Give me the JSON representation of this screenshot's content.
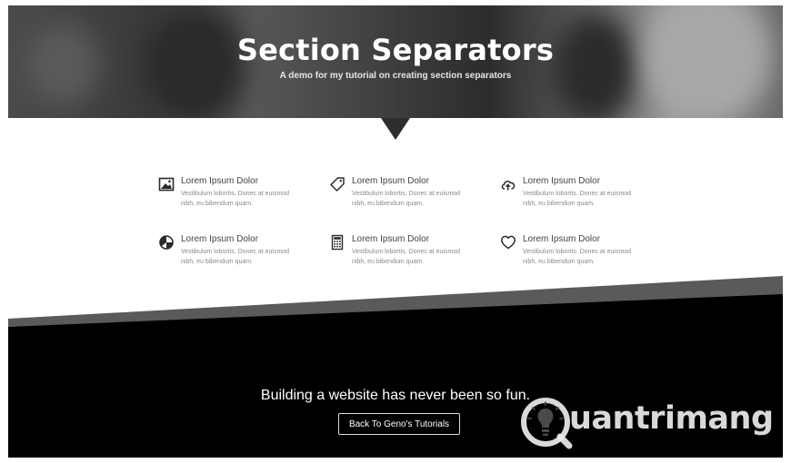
{
  "hero": {
    "title": "Section Separators",
    "subtitle": "A demo for my tutorial on creating section separators"
  },
  "features": [
    {
      "icon": "image-icon",
      "title": "Lorem Ipsum Dolor",
      "description": "Vestibulum lobortis. Donec at euismod nibh, eu bibendum quam."
    },
    {
      "icon": "tag-icon",
      "title": "Lorem Ipsum Dolor",
      "description": "Vestibulum lobortis. Donec at euismod nibh, eu bibendum quam."
    },
    {
      "icon": "cloud-upload-icon",
      "title": "Lorem Ipsum Dolor",
      "description": "Vestibulum lobortis. Donec at euismod nibh, eu bibendum quam."
    },
    {
      "icon": "pie-chart-icon",
      "title": "Lorem Ipsum Dolor",
      "description": "Vestibulum lobortis. Donec at euismod nibh, eu bibendum quam."
    },
    {
      "icon": "calculator-icon",
      "title": "Lorem Ipsum Dolor",
      "description": "Vestibulum lobortis. Donec at euismod nibh, eu bibendum quam."
    },
    {
      "icon": "heart-icon",
      "title": "Lorem Ipsum Dolor",
      "description": "Vestibulum lobortis. Donec at euismod nibh, eu bibendum quam."
    }
  ],
  "footer": {
    "tagline": "Building a website has never been so fun.",
    "button_label": "Back To Geno's Tutorials"
  },
  "watermark": {
    "text": "uantrimang",
    "icon": "lightbulb-icon"
  },
  "colors": {
    "hero_dark": "#3a3a3a",
    "dark_section": "#000000",
    "separator_stripe": "#5a5a5a",
    "feature_title": "#444444",
    "feature_text": "#8a8a8a"
  }
}
